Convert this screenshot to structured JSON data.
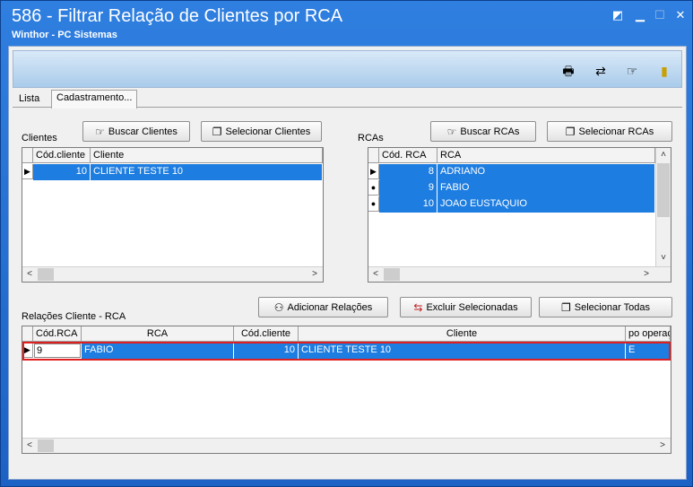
{
  "window": {
    "title": "586 - Filtrar Relação de Clientes por RCA",
    "subtitle": "Winthor - PC Sistemas"
  },
  "toolbar_icons": [
    "printer-icon",
    "refresh-icon",
    "hand-pointer-icon",
    "exit-door-icon"
  ],
  "tabs": [
    {
      "label": "Lista"
    },
    {
      "label": "Cadastramento..."
    }
  ],
  "clientes": {
    "label": "Clientes",
    "buscar_label": "Buscar Clientes",
    "selecionar_label": "Selecionar Clientes",
    "columns": [
      "Cód.cliente",
      "Cliente"
    ],
    "rows": [
      {
        "codigo": "10",
        "nome": "CLIENTE TESTE 10"
      }
    ]
  },
  "rcas": {
    "label": "RCAs",
    "buscar_label": "Buscar RCAs",
    "selecionar_label": "Selecionar RCAs",
    "columns": [
      "Cód. RCA",
      "RCA"
    ],
    "rows": [
      {
        "codigo": "8",
        "nome": "ADRIANO"
      },
      {
        "codigo": "9",
        "nome": "FABIO"
      },
      {
        "codigo": "10",
        "nome": "JOAO EUSTAQUIO"
      }
    ]
  },
  "relacoes": {
    "label": "Relações Cliente - RCA",
    "adicionar_label": "Adicionar Relações",
    "excluir_label": "Excluir Selecionadas",
    "selecionar_todas_label": "Selecionar Todas",
    "columns": [
      "Cód.RCA",
      "RCA",
      "Cód.cliente",
      "Cliente",
      "po operaçã"
    ],
    "rows": [
      {
        "cod_rca": "9",
        "rca": "FABIO",
        "cod_cliente": "10",
        "cliente": "CLIENTE TESTE 10",
        "operacao": "E"
      }
    ]
  }
}
